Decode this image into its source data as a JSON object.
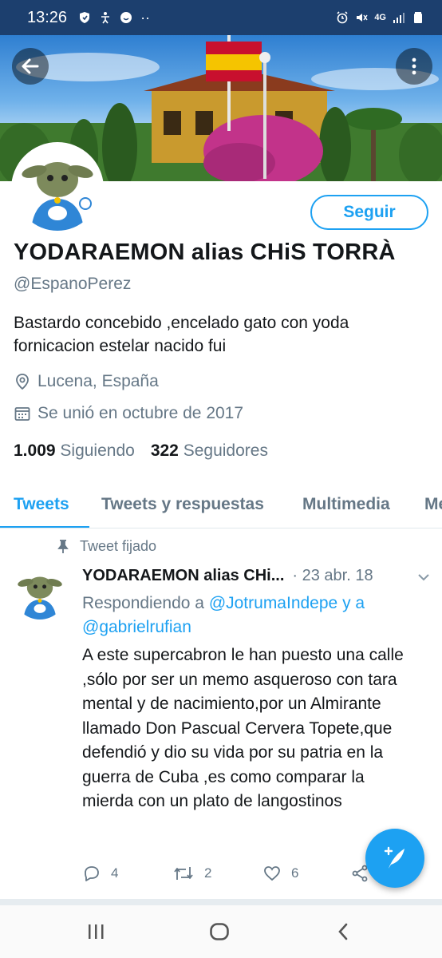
{
  "status_bar": {
    "time": "13:26",
    "network": "4G",
    "dots": "··"
  },
  "profile": {
    "display_name": "YODARAEMON alias CHiS TORRÀ",
    "handle": "@EspanoPerez",
    "bio": "Bastardo concebido ,encelado gato con yoda fornicacion estelar nacido fui",
    "location": "Lucena, España",
    "joined": "Se unió en octubre de 2017",
    "following_count": "1.009",
    "following_label": "Siguiendo",
    "followers_count": "322",
    "followers_label": "Seguidores",
    "follow_button": "Seguir"
  },
  "tabs": [
    {
      "label": "Tweets",
      "active": true
    },
    {
      "label": "Tweets y respuestas",
      "active": false
    },
    {
      "label": "Multimedia",
      "active": false
    },
    {
      "label": "Me",
      "active": false
    }
  ],
  "tweet": {
    "pinned_label": "Tweet fijado",
    "author": "YODARAEMON alias CHi...",
    "date": "· 23 abr. 18",
    "reply_prefix": "Respondiendo a",
    "mention_1": "@JotrumaIndepe",
    "reply_and": "y a",
    "mention_2": "@gabrielrufian",
    "text": "A este supercabron le han puesto una calle ,sólo por ser un memo asqueroso con tara mental y de nacimiento,por un Almirante llamado Don Pascual Cervera Topete,que defendió y dio su vida por su patria en la guerra de Cuba ,es como comparar la mierda con un plato de langostinos",
    "replies": "4",
    "retweets": "2",
    "likes": "6"
  },
  "colors": {
    "accent": "#1da1f2",
    "secondary_text": "#657786",
    "status_bar": "#1c3f6e"
  }
}
